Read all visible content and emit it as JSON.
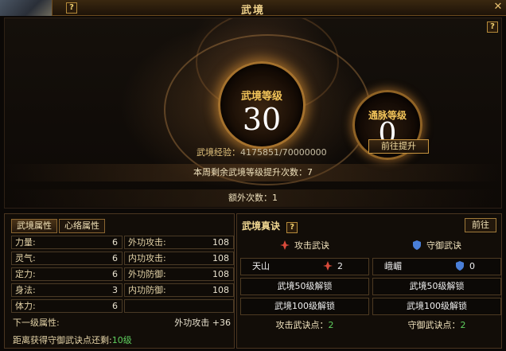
{
  "window": {
    "title": "武境",
    "help_label": "?",
    "close_label": "✕"
  },
  "top": {
    "main_orb": {
      "label": "武境等级",
      "value": "30"
    },
    "side_orb": {
      "label": "通脉等级",
      "value": "0"
    },
    "exp_label": "武境经验：",
    "exp_value": "4175851/70000000",
    "upgrade_button": "前往提升",
    "weekly_remaining": "本周剩余武境等级提升次数：7",
    "extra_count": "额外次数：1"
  },
  "left_panel": {
    "tabs": [
      "武境属性",
      "心络属性"
    ],
    "attributes": [
      {
        "name": "力量:",
        "value": "6",
        "name2": "外功攻击:",
        "value2": "108"
      },
      {
        "name": "灵气:",
        "value": "6",
        "name2": "内功攻击:",
        "value2": "108"
      },
      {
        "name": "定力:",
        "value": "6",
        "name2": "外功防御:",
        "value2": "108"
      },
      {
        "name": "身法:",
        "value": "3",
        "name2": "内功防御:",
        "value2": "108"
      },
      {
        "name": "体力:",
        "value": "6",
        "name2": "",
        "value2": ""
      }
    ],
    "next_label": "下一级属性:",
    "next_value": "外功攻击 +36",
    "distance_prefix": "距离获得守御武诀点还剩:",
    "distance_value": "10级"
  },
  "right_panel": {
    "title": "武境真诀",
    "help_label": "?",
    "goto_label": "前往",
    "attack": {
      "header": "攻击武诀",
      "skill_name": "天山",
      "skill_count": "2",
      "unlock_50": "武境50级解锁",
      "unlock_100": "武境100级解锁",
      "points_label": "攻击武诀点：",
      "points_value": "2"
    },
    "defense": {
      "header": "守御武诀",
      "skill_name": "峨嵋",
      "skill_count": "0",
      "unlock_50": "武境50级解锁",
      "unlock_100": "武境100级解锁",
      "points_label": "守御武诀点：",
      "points_value": "2"
    }
  },
  "colors": {
    "accent": "#f3c55a",
    "green": "#5fd05f",
    "border": "#a4712d"
  }
}
